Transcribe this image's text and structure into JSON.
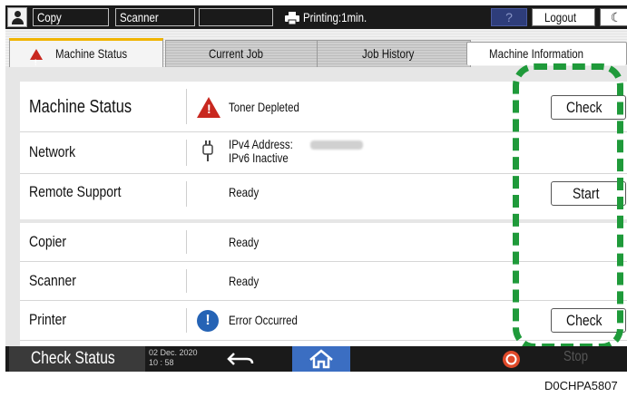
{
  "topbar": {
    "copy_label": "Copy",
    "scanner_label": "Scanner",
    "printing_status": "Printing:1min.",
    "help_label": "?",
    "logout_label": "Logout",
    "moon_glyph": "☾"
  },
  "tabs": [
    {
      "label": "Machine Status",
      "active": true
    },
    {
      "label": "Current Job",
      "active": false
    },
    {
      "label": "Job History",
      "active": false
    },
    {
      "label": "Machine Information",
      "active": false
    }
  ],
  "rows": {
    "machine_status": {
      "label": "Machine Status",
      "status": "Toner Depleted",
      "button": "Check",
      "icon": "warning-icon"
    },
    "network": {
      "label": "Network",
      "status_line1": "IPv4 Address:",
      "status_line2": "IPv6 Inactive",
      "icon": "network-plug-icon"
    },
    "remote_support": {
      "label": "Remote Support",
      "status": "Ready",
      "button": "Start"
    },
    "copier": {
      "label": "Copier",
      "status": "Ready"
    },
    "scanner": {
      "label": "Scanner",
      "status": "Ready"
    },
    "printer": {
      "label": "Printer",
      "status": "Error Occurred",
      "button": "Check",
      "icon": "info-icon"
    }
  },
  "bottombar": {
    "check_status_label": "Check Status",
    "date": "02 Dec. 2020",
    "time": "10 : 58",
    "stop_label": "Stop"
  },
  "caption": "D0CHPA5807",
  "colors": {
    "highlight": "#1f9a3a",
    "warning": "#c8281f",
    "info": "#2563b5",
    "active_tab_accent": "#f0b400",
    "home_button": "#3b6ec2"
  }
}
